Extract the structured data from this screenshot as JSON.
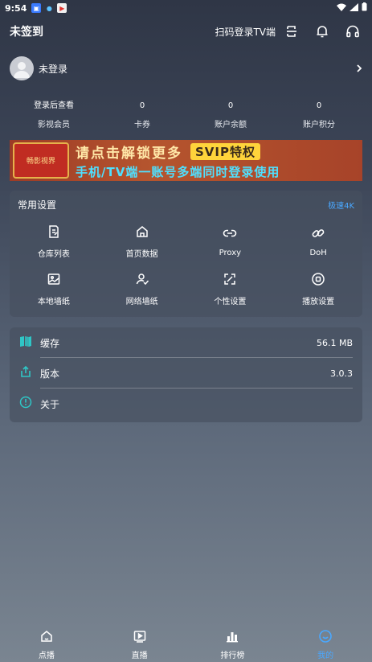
{
  "status": {
    "time": "9:54"
  },
  "header": {
    "title": "未签到",
    "scan_label": "扫码登录TV端"
  },
  "profile": {
    "name": "未登录"
  },
  "stats": [
    {
      "value": "登录后查看",
      "label": "影视会员"
    },
    {
      "value": "0",
      "label": "卡券"
    },
    {
      "value": "0",
      "label": "账户余额"
    },
    {
      "value": "0",
      "label": "账户积分"
    }
  ],
  "banner": {
    "line1": "请点击解锁更多",
    "badge": "SVIP特权",
    "line2": "手机/TV端一账号多端同时登录使用",
    "logo_text": "畅影视界"
  },
  "settings": {
    "title": "常用设置",
    "link": "极速4K",
    "items": [
      {
        "label": "仓库列表",
        "icon": "repository-icon"
      },
      {
        "label": "首页数据",
        "icon": "home-icon"
      },
      {
        "label": "Proxy",
        "icon": "link-icon"
      },
      {
        "label": "DoH",
        "icon": "chain-icon"
      },
      {
        "label": "本地墙纸",
        "icon": "image-icon"
      },
      {
        "label": "网络墙纸",
        "icon": "user-check-icon"
      },
      {
        "label": "个性设置",
        "icon": "expand-icon"
      },
      {
        "label": "播放设置",
        "icon": "play-circle-icon"
      }
    ]
  },
  "info": [
    {
      "label": "缓存",
      "value": "56.1 MB",
      "icon": "book-icon"
    },
    {
      "label": "版本",
      "value": "3.0.3",
      "icon": "share-icon"
    },
    {
      "label": "关于",
      "value": "",
      "icon": "info-icon"
    }
  ],
  "nav": [
    {
      "label": "点播",
      "icon": "home-icon"
    },
    {
      "label": "直播",
      "icon": "play-icon"
    },
    {
      "label": "排行榜",
      "icon": "chart-icon"
    },
    {
      "label": "我的",
      "icon": "profile-icon"
    }
  ],
  "colors": {
    "accent": "#4aa8ff",
    "teal": "#2fc6c6"
  }
}
